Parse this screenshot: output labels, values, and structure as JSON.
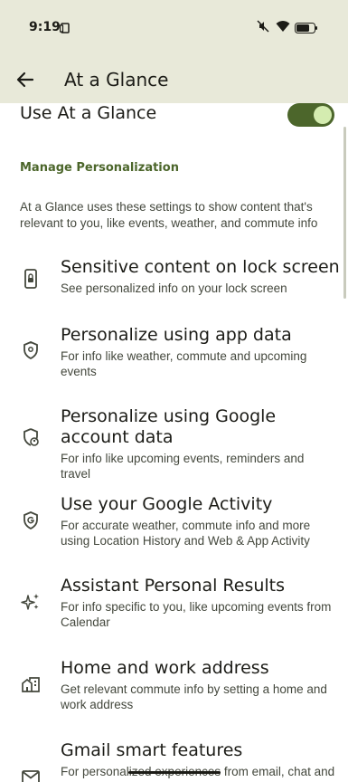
{
  "status": {
    "time": "9:19"
  },
  "appbar": {
    "title": "At a Glance"
  },
  "master_switch": {
    "label": "Use At a Glance",
    "on": true
  },
  "section": {
    "header": "Manage Personalization",
    "description": "At a Glance uses these settings to show content that's relevant to you, like events, weather, and commute info"
  },
  "items": [
    {
      "icon": "lock-screen-phone-icon",
      "title": "Sensitive content on lock screen",
      "subtitle": "See personalized info on your lock screen"
    },
    {
      "icon": "shield-icon",
      "title": "Personalize using app data",
      "subtitle": "For info like weather, commute and upcoming events"
    },
    {
      "icon": "shield-account-icon",
      "title": "Personalize using Google account data",
      "subtitle": "For info like upcoming events, reminders and travel"
    },
    {
      "icon": "google-shield-icon",
      "title": "Use your Google Activity",
      "subtitle": "For accurate weather, commute info and more using Location History and Web & App Activity"
    },
    {
      "icon": "sparkle-icon",
      "title": "Assistant Personal Results",
      "subtitle": "For info specific to you, like upcoming events from Calendar"
    },
    {
      "icon": "home-work-icon",
      "title": "Home and work address",
      "subtitle": "Get relevant commute info by setting a home and work address"
    },
    {
      "icon": "mail-icon",
      "title": "Gmail smart features",
      "subtitle": "For personalized experiences from email, chat and video, such as trip, flight details and other travel info"
    }
  ],
  "colors": {
    "accent": "#4c662b",
    "bar_bg": "#e8e9d9"
  }
}
